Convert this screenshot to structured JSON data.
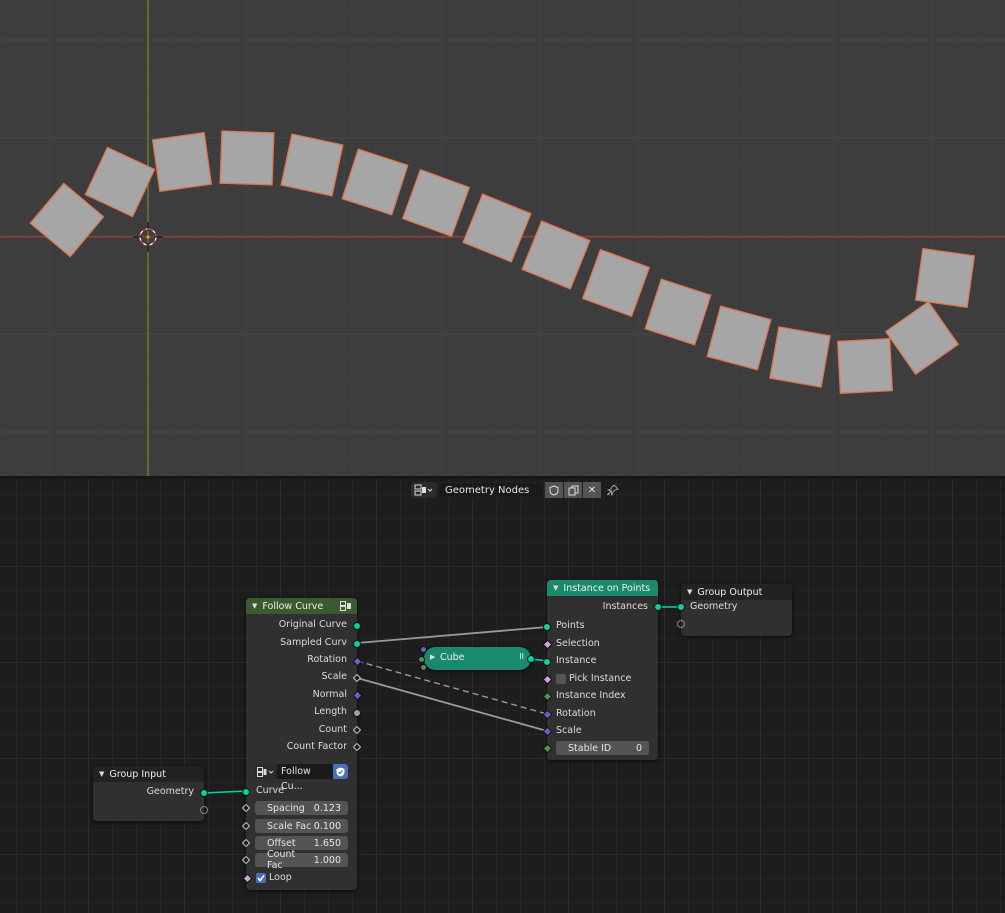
{
  "viewport": {
    "grid_color": "#4a4a4a",
    "x_axis_color": "#a83a3a",
    "y_axis_color": "#6b8e23",
    "instance_fill": "#a6a6a6",
    "instance_outline": "#e0744a"
  },
  "header": {
    "tree_type_icon": "node-tree-icon",
    "tree_name": "Geometry Nodes",
    "fake_user_icon": "shield-icon",
    "duplicate_icon": "duplicate-icon",
    "unlink_icon": "close-icon",
    "pin_icon": "pin-icon"
  },
  "nodes": {
    "follow_curve": {
      "title": "Follow Curve",
      "header_color": "#3b5a2e",
      "outputs": [
        "Original Curve",
        "Sampled Curv",
        "Rotation",
        "Scale",
        "Normal",
        "Length",
        "Count",
        "Count Factor"
      ],
      "group_select": "Follow Cu...",
      "input_curve": "Curve",
      "fields": [
        {
          "label": "Spacing",
          "value": "0.123"
        },
        {
          "label": "Scale Fac",
          "value": "0.100"
        },
        {
          "label": "Offset",
          "value": "1.650"
        },
        {
          "label": "Count Fac",
          "value": "1.000"
        }
      ],
      "loop_label": "Loop",
      "loop_checked": true
    },
    "cube": {
      "title": "Cube",
      "color": "#1a8a6e"
    },
    "instance_on_points": {
      "title": "Instance on Points",
      "header_color": "#1a8a6e",
      "output": "Instances",
      "inputs": [
        "Points",
        "Selection",
        "Instance",
        "Pick Instance",
        "Instance Index",
        "Rotation",
        "Scale"
      ],
      "stable_id_label": "Stable ID",
      "stable_id_value": "0"
    },
    "group_output": {
      "title": "Group Output",
      "input": "Geometry"
    },
    "group_input": {
      "title": "Group Input",
      "output": "Geometry"
    }
  }
}
